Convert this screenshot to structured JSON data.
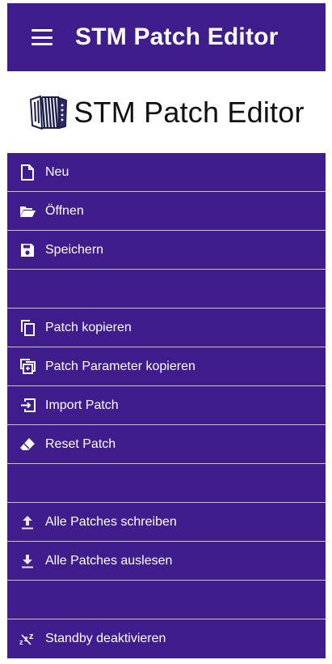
{
  "app_bar": {
    "title": "STM Patch Editor",
    "menu_icon": "hamburger-menu-icon",
    "background_color": "#3f1d8c"
  },
  "drawer_header": {
    "title": "STM Patch Editor",
    "logo_icon": "accordion-icon"
  },
  "menu": {
    "background_color": "#3f1d8c",
    "divider_color": "#c9c0e2",
    "items": [
      {
        "label": "Neu",
        "icon": "new-file-icon"
      },
      {
        "label": "Öffnen",
        "icon": "folder-open-icon"
      },
      {
        "label": "Speichern",
        "icon": "save-icon"
      },
      {
        "label": "",
        "icon": ""
      },
      {
        "label": "Patch kopieren",
        "icon": "copy-icon"
      },
      {
        "label": "Patch Parameter kopieren",
        "icon": "copy-parameters-icon"
      },
      {
        "label": "Import Patch",
        "icon": "import-icon"
      },
      {
        "label": "Reset Patch",
        "icon": "eraser-icon"
      },
      {
        "label": "",
        "icon": ""
      },
      {
        "label": "Alle Patches schreiben",
        "icon": "upload-icon"
      },
      {
        "label": "Alle Patches auslesen",
        "icon": "download-icon"
      },
      {
        "label": "",
        "icon": ""
      },
      {
        "label": "Standby deaktivieren",
        "icon": "sleep-icon"
      }
    ]
  }
}
